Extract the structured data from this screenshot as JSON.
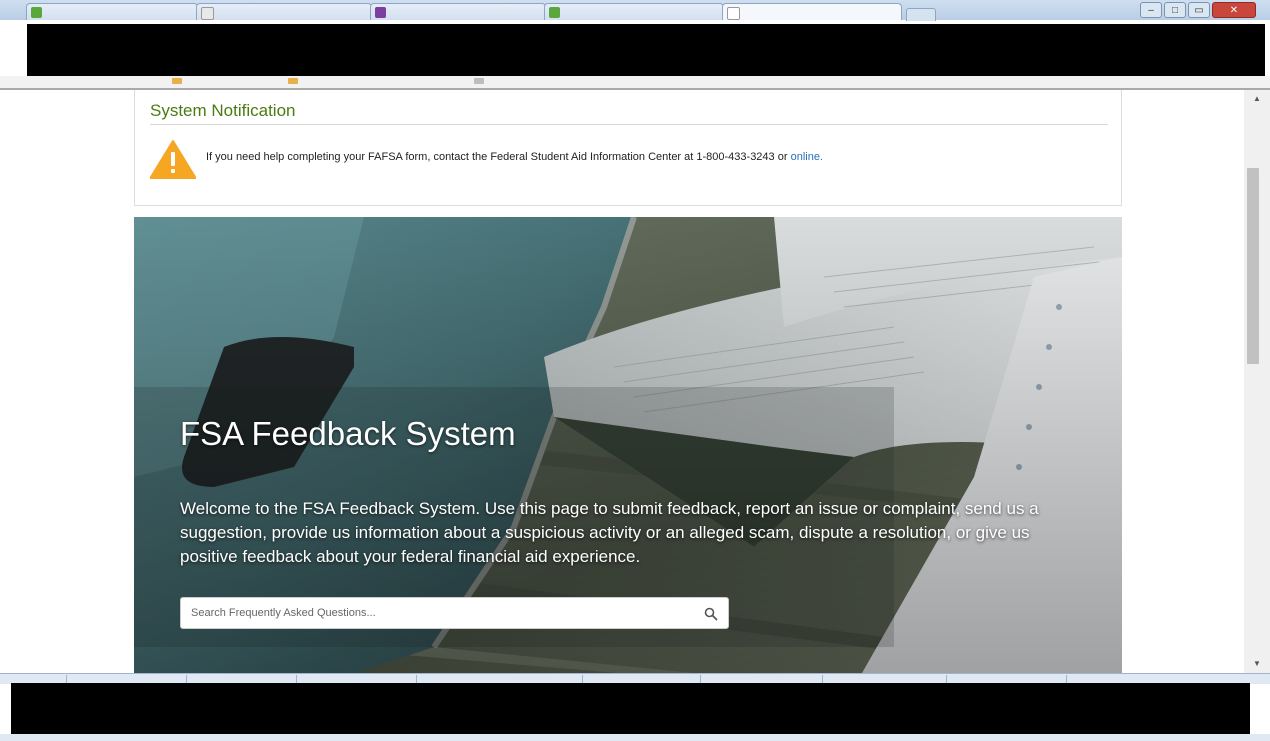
{
  "browser": {
    "tab_favicon_colors": [
      "#5aa83b",
      "#cccccc",
      "#7b3fa0",
      "#5aa83b",
      "#cccccc"
    ],
    "window_controls": {
      "minimize": "–",
      "maximize": "□",
      "close": "✕"
    }
  },
  "notification": {
    "title": "System Notification",
    "message": "If you need help completing your FAFSA form, contact the Federal Student Aid Information Center at 1-800-433-3243 or",
    "link_text": "online.",
    "icon": "warning-icon",
    "icon_color": "#f5a623",
    "title_color": "#4a7b13"
  },
  "hero": {
    "title": "FSA Feedback System",
    "description": "Welcome to the FSA Feedback System. Use this page to submit feedback, report an issue or complaint, send us a suggestion, provide us information about a suspicious activity or an alleged scam, dispute a resolution, or give us positive feedback about your federal financial aid experience.",
    "search": {
      "placeholder": "Search Frequently Asked Questions...",
      "value": "",
      "icon": "search-icon"
    }
  },
  "scrollbar": {
    "up_glyph": "▲",
    "down_glyph": "▼"
  }
}
